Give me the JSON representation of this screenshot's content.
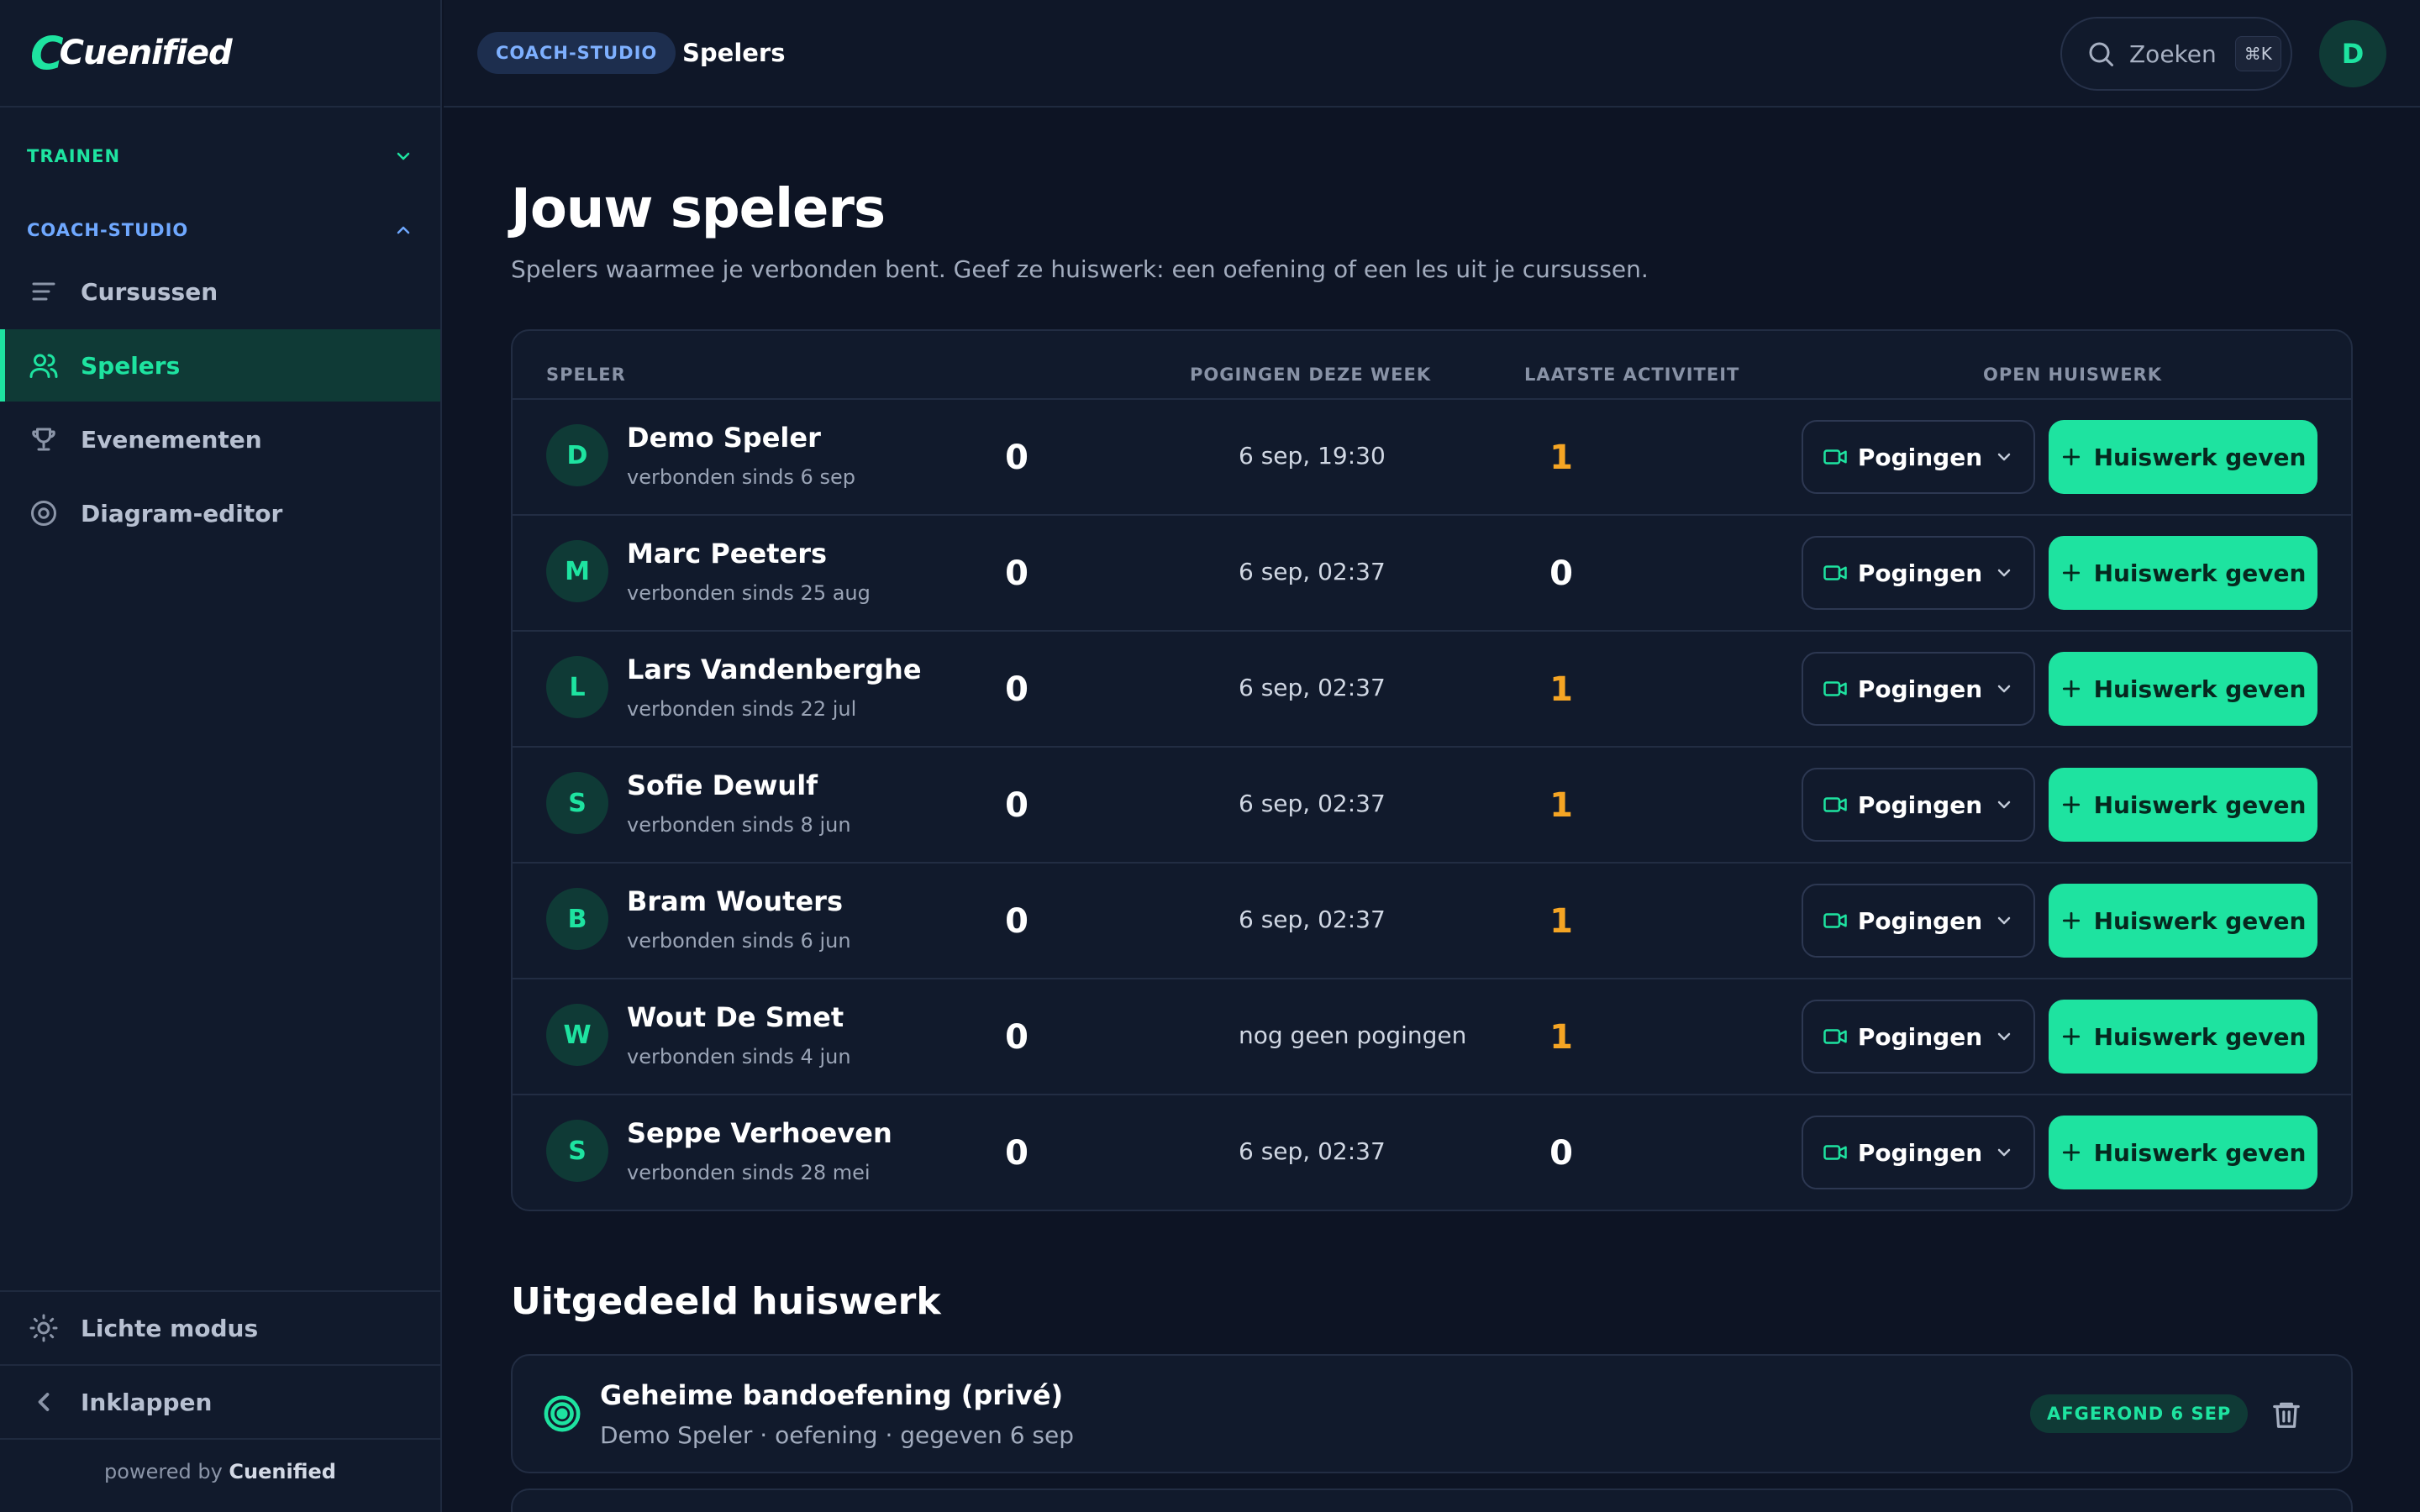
{
  "brand": {
    "name": "Cuenified"
  },
  "sidebar": {
    "sections": [
      {
        "label": "TRAINEN",
        "expanded": false
      },
      {
        "label": "COACH-STUDIO",
        "expanded": true
      }
    ],
    "items": [
      {
        "label": "Cursussen",
        "icon": "list-icon",
        "active": false
      },
      {
        "label": "Spelers",
        "icon": "users-icon",
        "active": true
      },
      {
        "label": "Evenementen",
        "icon": "trophy-icon",
        "active": false
      },
      {
        "label": "Diagram-editor",
        "icon": "target-icon",
        "active": false
      }
    ],
    "theme_toggle": "Lichte modus",
    "collapse": "Inklappen",
    "powered_prefix": "powered by",
    "powered_brand": "Cuenified"
  },
  "topbar": {
    "breadcrumb_badge": "COACH-STUDIO",
    "title": "Spelers",
    "search_label": "Zoeken",
    "search_shortcut": "⌘K",
    "avatar_initial": "D"
  },
  "main": {
    "title": "Jouw spelers",
    "subtitle": "Spelers waarmee je verbonden bent. Geef ze huiswerk: een oefening of een les uit je cursussen.",
    "columns": [
      "SPELER",
      "POGINGEN DEZE WEEK",
      "LAATSTE ACTIVITEIT",
      "OPEN HUISWERK"
    ],
    "players": [
      {
        "initial": "D",
        "name": "Demo Speler",
        "since": "verbonden sinds 6 sep",
        "attempts": "0",
        "last": "6 sep, 19:30",
        "open": "1"
      },
      {
        "initial": "M",
        "name": "Marc Peeters",
        "since": "verbonden sinds 25 aug",
        "attempts": "0",
        "last": "6 sep, 02:37",
        "open": "0"
      },
      {
        "initial": "L",
        "name": "Lars Vandenberghe",
        "since": "verbonden sinds 22 jul",
        "attempts": "0",
        "last": "6 sep, 02:37",
        "open": "1"
      },
      {
        "initial": "S",
        "name": "Sofie Dewulf",
        "since": "verbonden sinds 8 jun",
        "attempts": "0",
        "last": "6 sep, 02:37",
        "open": "1"
      },
      {
        "initial": "B",
        "name": "Bram Wouters",
        "since": "verbonden sinds 6 jun",
        "attempts": "0",
        "last": "6 sep, 02:37",
        "open": "1"
      },
      {
        "initial": "W",
        "name": "Wout De Smet",
        "since": "verbonden sinds 4 jun",
        "attempts": "0",
        "last": "nog geen pogingen",
        "open": "1"
      },
      {
        "initial": "S",
        "name": "Seppe Verhoeven",
        "since": "verbonden sinds 28 mei",
        "attempts": "0",
        "last": "6 sep, 02:37",
        "open": "0"
      }
    ],
    "attempts_button": "Pogingen",
    "assign_button": "Huiswerk geven"
  },
  "homework": {
    "title": "Uitgedeeld huiswerk",
    "items": [
      {
        "title": "Geheime bandoefening (privé)",
        "meta": "Demo Speler · oefening · gegeven 6 sep",
        "status": "AFGEROND 6 SEP"
      }
    ]
  },
  "colors": {
    "accent": "#1ee3a0",
    "amber": "#f5a524",
    "badge_blue": "#7eb0ff",
    "background": "#0d1424"
  }
}
